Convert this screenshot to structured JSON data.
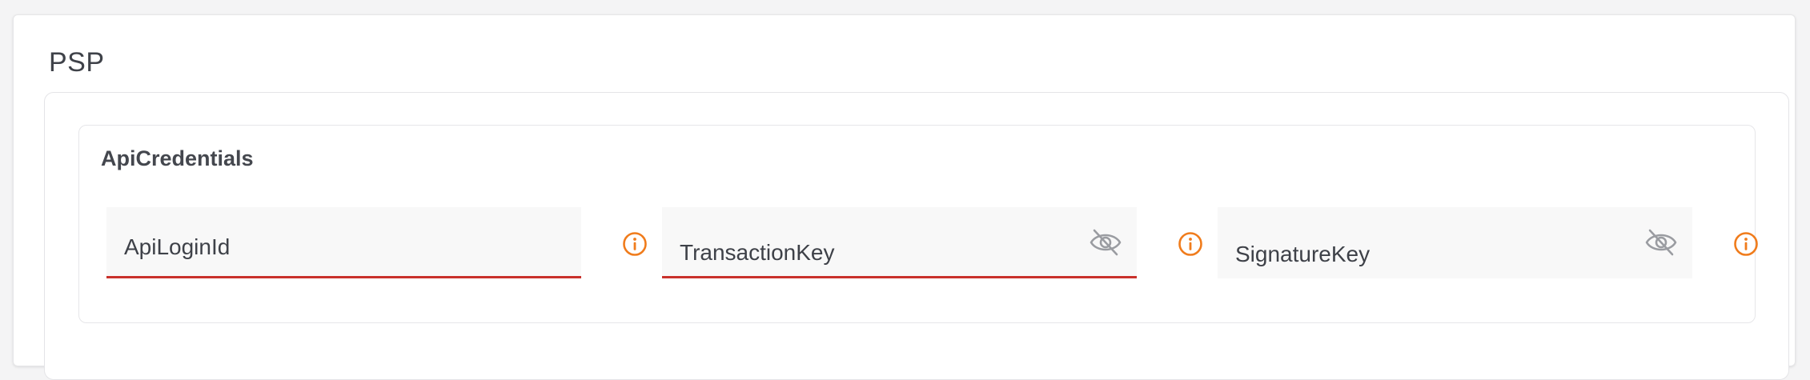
{
  "section": {
    "title": "PSP"
  },
  "group": {
    "title": "ApiCredentials"
  },
  "fields": [
    {
      "placeholder": "ApiLoginId",
      "icon": "info-icon"
    },
    {
      "placeholder": "TransactionKey",
      "toggle_icon": "eye-off-icon",
      "icon": "info-icon"
    },
    {
      "placeholder": "SignatureKey",
      "toggle_icon": "eye-off-icon",
      "icon": "info-icon"
    }
  ],
  "colors": {
    "accent": "#f07c1c",
    "error": "#c9312b",
    "field_bg": "#f8f8f8"
  }
}
